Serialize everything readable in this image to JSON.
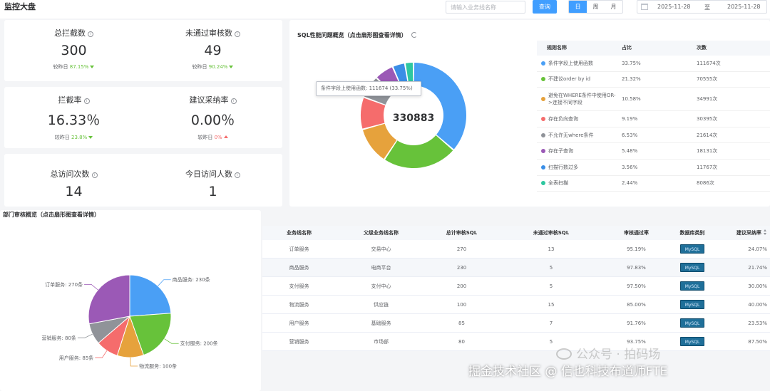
{
  "header": {
    "title": "监控大盘",
    "search_placeholder": "请输入业务线名称",
    "search_button": "查询",
    "range_tabs": [
      "日",
      "周",
      "月"
    ],
    "active_range": "日",
    "date_start": "2025-11-28",
    "date_sep": "至",
    "date_end": "2025-11-28"
  },
  "kpis": {
    "total_intercept": {
      "label": "总拦截数",
      "value": "300",
      "compare_label": "较昨日",
      "compare_value": "87.15%",
      "trend": "down"
    },
    "not_passed": {
      "label": "未通过审核数",
      "value": "49",
      "compare_label": "较昨日",
      "compare_value": "90.24%",
      "trend": "down"
    },
    "intercept_rate": {
      "label": "拦截率",
      "value": "16.33％",
      "compare_label": "较昨日",
      "compare_value": "23.8%",
      "trend": "down"
    },
    "adopt_rate": {
      "label": "建议采纳率",
      "value": "0.00％",
      "compare_label": "较昨日",
      "compare_value": "0%",
      "trend": "up"
    },
    "total_visits": {
      "label": "总访问次数",
      "value": "14"
    },
    "today_visitors": {
      "label": "今日访问人数",
      "value": "1"
    }
  },
  "sql_overview": {
    "title": "SQL性能问题概览（点击扇形图查看详情）",
    "total": "330883",
    "tooltip": "条件字段上使用函数: 111674 (33.75%)",
    "headers": [
      "规则名称",
      "占比",
      "次数"
    ],
    "rows": [
      {
        "name": "条件字段上使用函数",
        "pct": "33.75%",
        "count": "111674次",
        "color": "#4a9ff5"
      },
      {
        "name": "不建议order by id",
        "pct": "21.32%",
        "count": "70555次",
        "color": "#67c23a"
      },
      {
        "name": "避免在WHERE条件中使用OR->连接不同字段",
        "pct": "10.58%",
        "count": "34991次",
        "color": "#e6a23c"
      },
      {
        "name": "存在负向查询",
        "pct": "9.19%",
        "count": "30395次",
        "color": "#f56c6c"
      },
      {
        "name": "不允许无where条件",
        "pct": "6.53%",
        "count": "21614次",
        "color": "#909399"
      },
      {
        "name": "存在子查询",
        "pct": "5.48%",
        "count": "18131次",
        "color": "#9b59b6"
      },
      {
        "name": "扫描行数过多",
        "pct": "3.56%",
        "count": "11767次",
        "color": "#3a8ee6"
      },
      {
        "name": "全表扫描",
        "pct": "2.44%",
        "count": "8086次",
        "color": "#2ec7a0"
      }
    ]
  },
  "dept_overview": {
    "title": "部门审核概览（点击扇形图查看详情）",
    "pie_labels": [
      {
        "name": "商品服务",
        "text": "商品服务: 230条",
        "value": 230,
        "color": "#4a9ff5"
      },
      {
        "name": "支付服务",
        "text": "支付服务: 200条",
        "value": 200,
        "color": "#67c23a"
      },
      {
        "name": "物流服务",
        "text": "物流服务: 100条",
        "value": 100,
        "color": "#e6a23c"
      },
      {
        "name": "用户服务",
        "text": "用户服务: 85条",
        "value": 85,
        "color": "#f56c6c"
      },
      {
        "name": "营销服务",
        "text": "营销服务: 80条",
        "value": 80,
        "color": "#909399"
      },
      {
        "name": "订单服务",
        "text": "订单服务: 270条",
        "value": 270,
        "color": "#9b59b6"
      }
    ],
    "headers": [
      "业务线名称",
      "父级业务线名称",
      "总计审核SQL",
      "未通过审核SQL",
      "审核通过率",
      "数据库类别",
      "建议采纳率"
    ],
    "rows": [
      [
        "订单服务",
        "交易中心",
        "270",
        "13",
        "95.19%",
        "MySQL",
        "24.07%"
      ],
      [
        "商品服务",
        "电商平台",
        "230",
        "5",
        "97.83%",
        "MySQL",
        "21.74%"
      ],
      [
        "支付服务",
        "支付中心",
        "200",
        "5",
        "97.50%",
        "MySQL",
        "30.00%"
      ],
      [
        "物流服务",
        "供应链",
        "100",
        "15",
        "85.00%",
        "MySQL",
        "40.00%"
      ],
      [
        "用户服务",
        "基础服务",
        "85",
        "7",
        "91.76%",
        "MySQL",
        "23.53%"
      ],
      [
        "营销服务",
        "市场部",
        "80",
        "5",
        "93.75%",
        "MySQL",
        "87.50%"
      ]
    ]
  },
  "watermark": {
    "line1": "公众号 · 拍码场",
    "line2": "掘金技术社区 @ 信也科技布道师FTE"
  }
}
